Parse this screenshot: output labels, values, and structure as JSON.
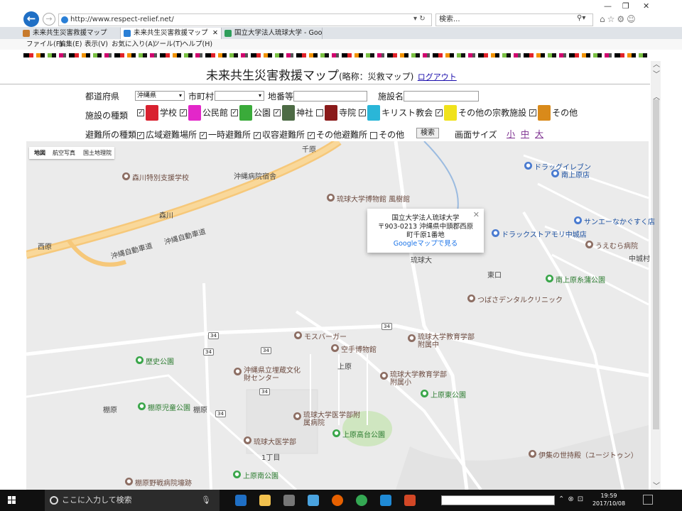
{
  "browser": {
    "url": "http://www.respect-relief.net/",
    "search_placeholder": "検索...",
    "tabs": [
      {
        "label": "未来共生災害救援マップ",
        "active": false
      },
      {
        "label": "未来共生災害救援マップ",
        "active": true
      },
      {
        "label": "国立大学法人琉球大学 - Googl...",
        "active": false
      }
    ],
    "menu": [
      "ファイル(F)",
      "編集(E)",
      "表示(V)",
      "お気に入り(A)",
      "ツール(T)",
      "ヘルプ(H)"
    ]
  },
  "page": {
    "title": "未来共生災害救援マップ",
    "title_sub": "(略称：災救マップ)",
    "logout": "ログアウト",
    "filters": {
      "prefecture_label": "都道府県",
      "prefecture_value": "沖縄県",
      "city_label": "市町村",
      "address_label": "地番等",
      "facility_label": "施設名",
      "facility_types_label": "施設の種類",
      "facility_types": [
        {
          "label": "学校",
          "checked": true,
          "color": "#d9212f"
        },
        {
          "label": "公民館",
          "checked": true,
          "color": "#e327c9"
        },
        {
          "label": "公園",
          "checked": true,
          "color": "#3aab3a"
        },
        {
          "label": "神社",
          "checked": true,
          "color": "#4d6b45"
        },
        {
          "label": "寺院",
          "checked": false,
          "color": "#8a1a1a"
        },
        {
          "label": "キリスト教会",
          "checked": true,
          "color": "#2ab6d8"
        },
        {
          "label": "その他の宗教施設",
          "checked": true,
          "color": "#f0e21b"
        },
        {
          "label": "その他",
          "checked": true,
          "color": "#d98a1a"
        }
      ],
      "shelter_types_label": "避難所の種類",
      "shelter_types": [
        {
          "label": "広域避難場所",
          "checked": true
        },
        {
          "label": "一時避難所",
          "checked": true
        },
        {
          "label": "収容避難所",
          "checked": true
        },
        {
          "label": "その他避難所",
          "checked": true
        },
        {
          "label": "その他",
          "checked": false
        }
      ],
      "search_button": "検索",
      "screen_size_label": "画面サイズ",
      "sizes": [
        "小",
        "中",
        "大"
      ]
    }
  },
  "map": {
    "type_buttons": [
      "地図",
      "航空写真",
      "国土地理院"
    ],
    "infowindow": {
      "name": "国立大学法人琉球大学",
      "address1": "〒903-0213 沖縄県中頭郡西原",
      "address2": "町千原1番地",
      "link": "Googleマップで見る"
    },
    "labels": [
      {
        "text": "千原",
        "kind": "plain"
      },
      {
        "text": "森川特別支援学校",
        "kind": "brn"
      },
      {
        "text": "沖縄病院宿舎",
        "kind": "plain"
      },
      {
        "text": "琉球大学博物館 風樹館",
        "kind": "brn"
      },
      {
        "text": "森川",
        "kind": "plain"
      },
      {
        "text": "沖縄自動車道",
        "kind": "plain"
      },
      {
        "text": "沖縄自動車道",
        "kind": "plain"
      },
      {
        "text": "ドラッグイレブン",
        "kind": "blu"
      },
      {
        "text": "南上原店",
        "kind": "blu"
      },
      {
        "text": "サンエーなかぐすく店",
        "kind": "blu"
      },
      {
        "text": "ドラックストアモリ中城店",
        "kind": "blu"
      },
      {
        "text": "うえむら病院",
        "kind": "brn"
      },
      {
        "text": "中城村",
        "kind": "plain"
      },
      {
        "text": "南上原糸蒲公園",
        "kind": "grn"
      },
      {
        "text": "つばさデンタルクリニック",
        "kind": "brn"
      },
      {
        "text": "琉球大学教育学部附属中",
        "kind": "brn"
      },
      {
        "text": "モスバーガー",
        "kind": "brn"
      },
      {
        "text": "空手博物館",
        "kind": "brn"
      },
      {
        "text": "上原",
        "kind": "plain"
      },
      {
        "text": "歴史公園",
        "kind": "grn"
      },
      {
        "text": "沖縄県立埋蔵文化財センター",
        "kind": "brn"
      },
      {
        "text": "琉球大学教育学部附属小",
        "kind": "brn"
      },
      {
        "text": "上原東公園",
        "kind": "grn"
      },
      {
        "text": "棚原",
        "kind": "plain"
      },
      {
        "text": "棚原児童公園",
        "kind": "grn"
      },
      {
        "text": "棚原",
        "kind": "plain"
      },
      {
        "text": "琉球大学医学部附属病院",
        "kind": "brn"
      },
      {
        "text": "上原高台公園",
        "kind": "grn"
      },
      {
        "text": "琉球大医学部",
        "kind": "brn"
      },
      {
        "text": "伊集の世持殿（ユージトゥン）",
        "kind": "brn"
      },
      {
        "text": "上原南公園",
        "kind": "grn"
      },
      {
        "text": "棚原野戦病院壕跡",
        "kind": "brn"
      },
      {
        "text": "西原",
        "kind": "plain"
      },
      {
        "text": "琉球大",
        "kind": "plain"
      },
      {
        "text": "東口",
        "kind": "plain"
      },
      {
        "text": "1丁目",
        "kind": "plain"
      }
    ],
    "routes": [
      "34",
      "34",
      "34",
      "34",
      "34",
      "34"
    ]
  },
  "taskbar": {
    "search_placeholder": "ここに入力して検索",
    "time": "19:59",
    "date": "2017/10/08"
  }
}
